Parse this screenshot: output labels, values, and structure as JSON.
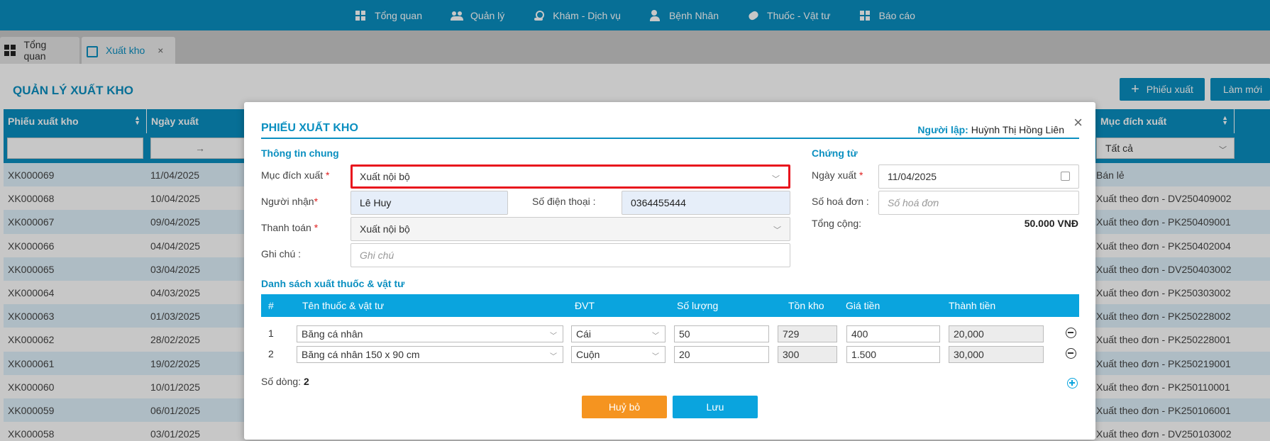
{
  "topnav": {
    "items": [
      {
        "label": "Tổng quan",
        "icon": "dashboard-icon"
      },
      {
        "label": "Quản lý",
        "icon": "users-icon"
      },
      {
        "label": "Khám - Dịch vụ",
        "icon": "stethoscope-icon"
      },
      {
        "label": "Bệnh Nhân",
        "icon": "patient-icon"
      },
      {
        "label": "Thuốc - Vật tư",
        "icon": "pill-icon"
      },
      {
        "label": "Báo cáo",
        "icon": "report-icon"
      }
    ]
  },
  "tabs": [
    {
      "label": "Tổng quan",
      "icon": "dashboard-icon"
    },
    {
      "label": "Xuất kho",
      "icon": "export-icon",
      "close": "×"
    }
  ],
  "page": {
    "title": "QUẢN LÝ XUẤT KHO",
    "btn_phieu_xuat": "Phiếu xuất",
    "btn_phieu_plus": "+",
    "btn_lam_moi": "Làm mới",
    "columns": {
      "phieu": "Phiếu xuất kho",
      "ngay": "Ngày xuất",
      "muc_dich": "Mục đích xuất"
    },
    "date_range_arrow": "→",
    "filter_muc_dich": "Tất cả",
    "rows": [
      {
        "phieu": "XK000069",
        "ngay": "11/04/2025",
        "muc_dich": "Bán lẻ"
      },
      {
        "phieu": "XK000068",
        "ngay": "10/04/2025",
        "muc_dich": "Xuất theo đơn - DV250409002"
      },
      {
        "phieu": "XK000067",
        "ngay": "09/04/2025",
        "muc_dich": "Xuất theo đơn - PK250409001"
      },
      {
        "phieu": "XK000066",
        "ngay": "04/04/2025",
        "muc_dich": "Xuất theo đơn - PK250402004"
      },
      {
        "phieu": "XK000065",
        "ngay": "03/04/2025",
        "muc_dich": "Xuất theo đơn - DV250403002"
      },
      {
        "phieu": "XK000064",
        "ngay": "04/03/2025",
        "muc_dich": "Xuất theo đơn - PK250303002"
      },
      {
        "phieu": "XK000063",
        "ngay": "01/03/2025",
        "muc_dich": "Xuất theo đơn - PK250228002"
      },
      {
        "phieu": "XK000062",
        "ngay": "28/02/2025",
        "muc_dich": "Xuất theo đơn - PK250228001"
      },
      {
        "phieu": "XK000061",
        "ngay": "19/02/2025",
        "muc_dich": "Xuất theo đơn - PK250219001"
      },
      {
        "phieu": "XK000060",
        "ngay": "10/01/2025",
        "muc_dich": "Xuất theo đơn - PK250110001"
      },
      {
        "phieu": "XK000059",
        "ngay": "06/01/2025",
        "muc_dich": "Xuất theo đơn - PK250106001"
      },
      {
        "phieu": "XK000058",
        "ngay": "03/01/2025",
        "muc_dich": "Xuất theo đơn - DV250103002"
      }
    ]
  },
  "modal": {
    "title": "PHIẾU XUẤT KHO",
    "creator_label": "Người lập:",
    "creator_name": "Huỳnh Thị Hồng Liên",
    "close": "×",
    "general_section": "Thông tin chung",
    "voucher_section": "Chứng từ",
    "muc_dich_label": "Mục đích xuất",
    "muc_dich_value": "Xuất nội bộ",
    "nguoi_nhan_label": "Người nhận",
    "nguoi_nhan_value": "Lê Huy",
    "sdt_label": "Số điện thoại :",
    "sdt_value": "0364455444",
    "thanh_toan_label": "Thanh toán",
    "thanh_toan_value": "Xuất nội bộ",
    "ghi_chu_label": "Ghi chú :",
    "ghi_chu_placeholder": "Ghi chú",
    "ngay_xuat_label": "Ngày xuất",
    "ngay_xuat_value": "11/04/2025",
    "so_hoa_don_label": "Số hoá đơn :",
    "so_hoa_don_placeholder": "Số hoá đơn",
    "tong_cong_label": "Tổng cộng:",
    "tong_cong_value": "50.000 VNĐ",
    "required_mark": "*",
    "list_section": "Danh sách xuất thuốc & vật tư",
    "table_headers": {
      "idx": "#",
      "name": "Tên thuốc & vật tư",
      "unit": "ĐVT",
      "qty": "Số lượng",
      "stock": "Tồn kho",
      "price": "Giá tiền",
      "amount": "Thành tiền"
    },
    "items": [
      {
        "idx": "1",
        "name": "Băng cá nhân",
        "unit": "Cái",
        "qty": "50",
        "stock": "729",
        "price": "400",
        "amount": "20,000"
      },
      {
        "idx": "2",
        "name": "Băng cá nhân 150 x 90 cm",
        "unit": "Cuộn",
        "qty": "20",
        "stock": "300",
        "price": "1.500",
        "amount": "30,000"
      }
    ],
    "row_count_label": "Số dòng:",
    "row_count": "2",
    "btn_cancel": "Huỷ bỏ",
    "btn_save": "Lưu"
  },
  "colors": {
    "primary": "#0a8fc0",
    "header_blue": "#0aa4de",
    "cancel_orange": "#f59420",
    "focus_red": "#e8141d"
  }
}
